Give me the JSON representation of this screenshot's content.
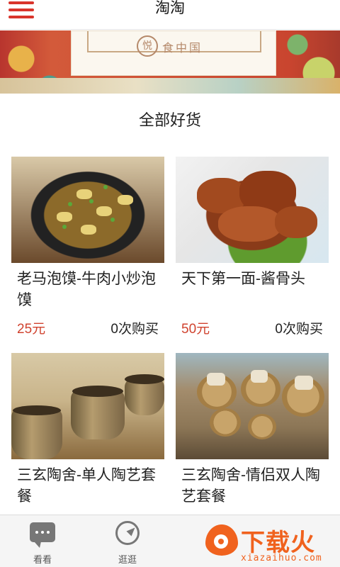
{
  "header": {
    "title": "淘淘"
  },
  "banner": {
    "logo_char": "悦",
    "text": "食中国"
  },
  "section": {
    "title": "全部好货"
  },
  "products": [
    {
      "name": "老马泡馍-牛肉小炒泡馍",
      "price": "25元",
      "sold": "0次购买"
    },
    {
      "name": "天下第一面-酱骨头",
      "price": "50元",
      "sold": "0次购买"
    },
    {
      "name": "三玄陶舍-单人陶艺套餐"
    },
    {
      "name": "三玄陶舍-情侣双人陶艺套餐"
    }
  ],
  "tabbar": {
    "tabs": [
      {
        "label": "看看",
        "icon": "chat-bubble-icon"
      },
      {
        "label": "逛逛",
        "icon": "compass-icon"
      }
    ]
  },
  "watermark": {
    "text": "下载火",
    "url": "xiazaihuo.com"
  },
  "colors": {
    "accent": "#d9342b",
    "price": "#d0432f",
    "watermark": "#f0621e"
  }
}
